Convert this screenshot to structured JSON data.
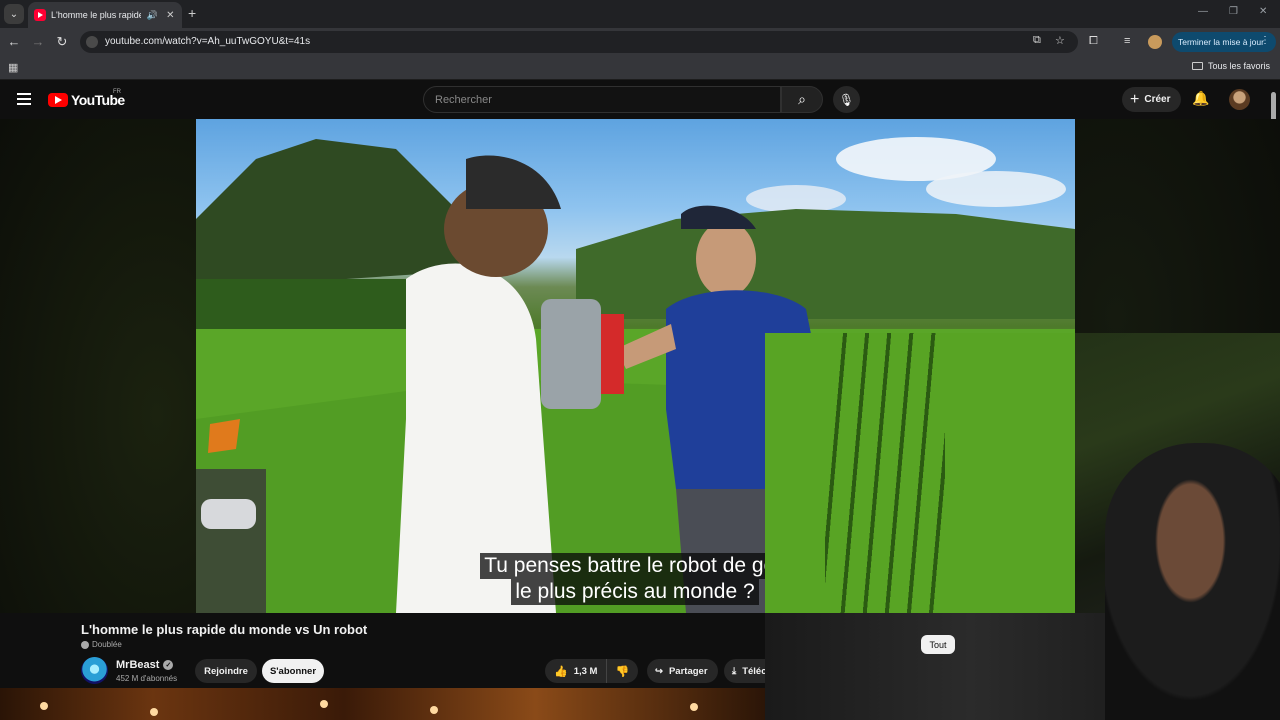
{
  "browser": {
    "tab_title": "L'homme le plus rapide du",
    "tab_audio_icon": "speaker-icon",
    "new_tab_label": "+",
    "url": "youtube.com/watch?v=Ah_uuTwGOYU&t=41s",
    "update_button_label": "Terminer la mise à jour",
    "bookmarks_folder_label": "Tous les favoris"
  },
  "youtube": {
    "logo_text": "YouTube",
    "country_code": "FR",
    "search_placeholder": "Rechercher",
    "create_label": "Créer"
  },
  "video": {
    "subtitle_line1": "Tu penses battre le robot de golf",
    "subtitle_line2": "le plus précis au monde ?",
    "title": "L'homme le plus rapide du monde vs Un robot",
    "dubbed_label": "Doublée",
    "chip_label": "Tout"
  },
  "channel": {
    "name": "MrBeast",
    "subscribers": "452 M d'abonnés",
    "join_label": "Rejoindre",
    "subscribe_label": "S'abonner"
  },
  "actions": {
    "likes": "1,3 M",
    "share_label": "Partager",
    "download_label": "Télécharger"
  },
  "colors": {
    "background": "#0f0f0f",
    "brand_red": "#ff0000",
    "update_button": "#0e4a6e"
  }
}
